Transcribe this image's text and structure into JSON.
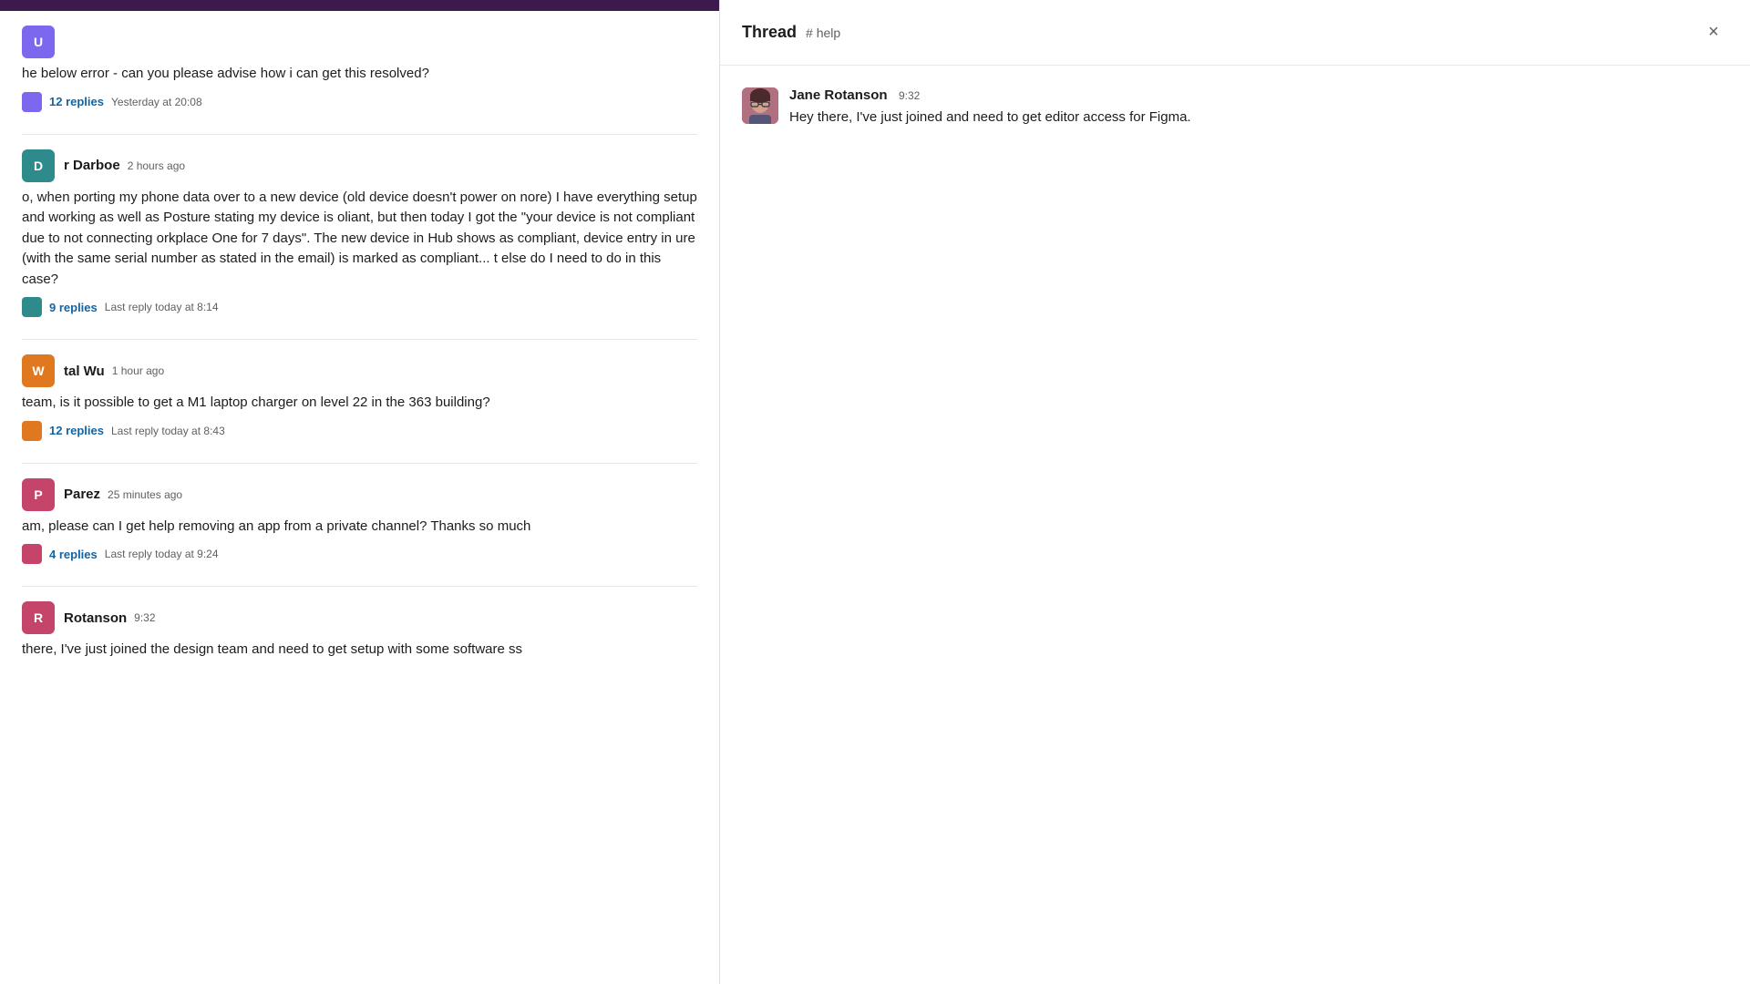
{
  "topbar": {
    "color": "#3d1a4d"
  },
  "left_panel": {
    "messages": [
      {
        "id": "msg1",
        "sender": "",
        "timestamp": "Yesterday at 20:08",
        "text": "he below error - can you please advise how i can get this resolved?",
        "replies": {
          "count": "12 replies",
          "time": "Yesterday at 20:08"
        },
        "avatar_color": "#7B68EE",
        "avatar_letter": "U"
      },
      {
        "id": "msg2",
        "sender": "r Darboe",
        "timestamp": "2 hours ago",
        "text": "o, when porting my phone data over to a new device (old device doesn't power on nore) I have everything setup and working as well as Posture stating my device is oliant, but then today I got the \"your device is not compliant due to not connecting orkplace One for 7 days\". The new device in Hub shows as compliant, device entry in ure (with the same serial number as stated in the email) is marked as compliant... t else do I need to do in this case?",
        "replies": {
          "count": "9 replies",
          "time": "Last reply today at 8:14"
        },
        "avatar_color": "#2e8b8b",
        "avatar_letter": "D"
      },
      {
        "id": "msg3",
        "sender": "tal Wu",
        "timestamp": "1 hour ago",
        "text": "team, is it possible to get a M1 laptop charger on level 22 in the 363 building?",
        "replies": {
          "count": "12 replies",
          "time": "Last reply today at 8:43"
        },
        "avatar_color": "#e07820",
        "avatar_letter": "W"
      },
      {
        "id": "msg4",
        "sender": "Parez",
        "timestamp": "25 minutes ago",
        "text": "am, please can I get help removing an app from a private channel? Thanks so much",
        "replies": {
          "count": "4 replies",
          "time": "Last reply today at 9:24"
        },
        "avatar_color": "#c44569",
        "avatar_letter": "P"
      },
      {
        "id": "msg5",
        "sender": "Rotanson",
        "timestamp": "9:32",
        "text": "there, I've just joined the design team and need to get setup with some software ss",
        "replies": null,
        "avatar_color": "#c44569",
        "avatar_letter": "R"
      }
    ]
  },
  "right_panel": {
    "header": {
      "title": "Thread",
      "channel": "# help",
      "close_label": "×"
    },
    "thread_message": {
      "sender": "Jane Rotanson",
      "timestamp": "9:32",
      "text": "Hey there, I've just joined and need to get editor access for Figma.",
      "avatar_color": "#b07080"
    }
  }
}
